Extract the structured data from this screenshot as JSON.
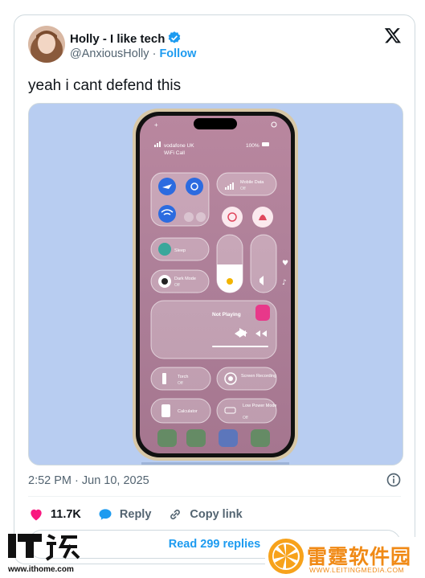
{
  "tweet": {
    "author_name": "Holly - I like tech",
    "handle": "@AnxiousHolly",
    "follow_label": "Follow",
    "text": "yeah i cant defend this",
    "timestamp": "2:52 PM · Jun 10, 2025",
    "likes": "11.7K",
    "reply_label": "Reply",
    "copy_link_label": "Copy link",
    "read_replies_label": "Read 299 replies"
  },
  "phone_screen": {
    "carrier": "vodafone UK",
    "wifi_call": "WiFi Call",
    "battery": "100%",
    "mobile_data_label": "Mobile Data",
    "mobile_data_state": "Off",
    "sleep_label": "Sleep",
    "dark_mode_label": "Dark Mode",
    "dark_mode_state": "Off",
    "now_playing": "Not Playing",
    "torch_label": "Torch",
    "torch_state": "Off",
    "screen_recording_label": "Screen Recording",
    "calculator_label": "Calculator",
    "low_power_label": "Low Power Mode",
    "low_power_state": "Off"
  },
  "watermarks": {
    "ithome_url": "www.ithome.com",
    "leiting_name": "雷霆软件园",
    "leiting_url": "WWW.LEITINGMEDIA.COM"
  },
  "colors": {
    "accent": "#1d9bf0",
    "like": "#f91880",
    "media_bg": "#b8cdf1"
  }
}
